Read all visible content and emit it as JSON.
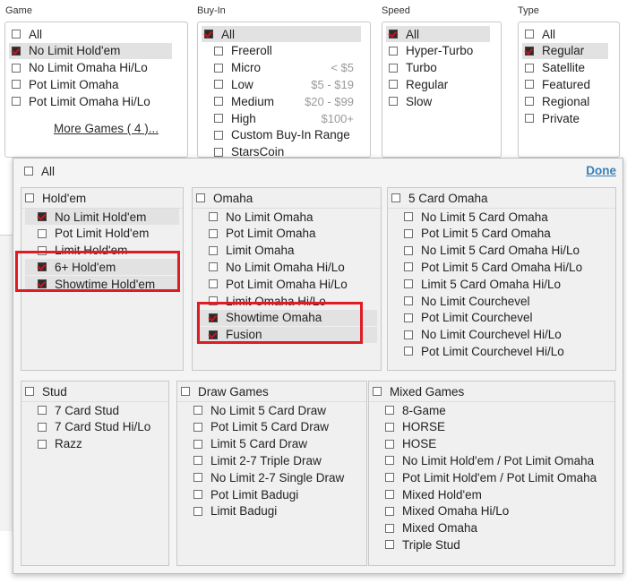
{
  "filters": {
    "game": {
      "label": "Game",
      "items": [
        {
          "label": "All",
          "checked": false
        },
        {
          "label": "No Limit Hold'em",
          "checked": true,
          "hl": true
        },
        {
          "label": "No Limit Omaha Hi/Lo",
          "checked": false
        },
        {
          "label": "Pot Limit Omaha",
          "checked": false
        },
        {
          "label": "Pot Limit Omaha Hi/Lo",
          "checked": false
        }
      ],
      "more_link": "More Games ( 4 )..."
    },
    "buyin": {
      "label": "Buy-In",
      "items": [
        {
          "label": "All",
          "checked": true,
          "hl": true,
          "price": ""
        },
        {
          "label": "Freeroll",
          "checked": false,
          "price": ""
        },
        {
          "label": "Micro",
          "checked": false,
          "price": "< $5"
        },
        {
          "label": "Low",
          "checked": false,
          "price": "$5 - $19"
        },
        {
          "label": "Medium",
          "checked": false,
          "price": "$20 - $99"
        },
        {
          "label": "High",
          "checked": false,
          "price": "$100+"
        },
        {
          "label": "Custom Buy-In Range",
          "checked": false,
          "price": ""
        },
        {
          "label": "StarsCoin",
          "checked": false,
          "price": ""
        }
      ]
    },
    "speed": {
      "label": "Speed",
      "items": [
        {
          "label": "All",
          "checked": true,
          "hl": true
        },
        {
          "label": "Hyper-Turbo",
          "checked": false
        },
        {
          "label": "Turbo",
          "checked": false
        },
        {
          "label": "Regular",
          "checked": false
        },
        {
          "label": "Slow",
          "checked": false
        }
      ]
    },
    "type": {
      "label": "Type",
      "items": [
        {
          "label": "All",
          "checked": false
        },
        {
          "label": "Regular",
          "checked": true,
          "hl": true
        },
        {
          "label": "Satellite",
          "checked": false
        },
        {
          "label": "Featured",
          "checked": false
        },
        {
          "label": "Regional",
          "checked": false
        },
        {
          "label": "Private",
          "checked": false
        }
      ]
    }
  },
  "popup": {
    "all_label": "All",
    "done_label": "Done",
    "groups": [
      {
        "id": "holdem",
        "title": "Hold'em",
        "items": [
          {
            "label": "No Limit Hold'em",
            "checked": true,
            "hl": true
          },
          {
            "label": "Pot Limit Hold'em",
            "checked": false
          },
          {
            "label": "Limit Hold'em",
            "checked": false
          },
          {
            "label": "6+ Hold'em",
            "checked": true,
            "hl": true
          },
          {
            "label": "Showtime Hold'em",
            "checked": true,
            "hl": true
          }
        ]
      },
      {
        "id": "omaha",
        "title": "Omaha",
        "items": [
          {
            "label": "No Limit Omaha",
            "checked": false
          },
          {
            "label": "Pot Limit Omaha",
            "checked": false
          },
          {
            "label": "Limit Omaha",
            "checked": false
          },
          {
            "label": "No Limit Omaha Hi/Lo",
            "checked": false
          },
          {
            "label": "Pot Limit Omaha Hi/Lo",
            "checked": false
          },
          {
            "label": "Limit Omaha Hi/Lo",
            "checked": false
          },
          {
            "label": "Showtime Omaha",
            "checked": true,
            "hl": true
          },
          {
            "label": "Fusion",
            "checked": true,
            "hl": true
          }
        ]
      },
      {
        "id": "five-card-omaha",
        "title": "5 Card Omaha",
        "items": [
          {
            "label": "No Limit 5 Card Omaha",
            "checked": false
          },
          {
            "label": "Pot Limit 5 Card Omaha",
            "checked": false
          },
          {
            "label": "No Limit 5 Card Omaha Hi/Lo",
            "checked": false
          },
          {
            "label": "Pot Limit 5 Card Omaha Hi/Lo",
            "checked": false
          },
          {
            "label": "Limit 5 Card Omaha Hi/Lo",
            "checked": false
          },
          {
            "label": "No Limit Courchevel",
            "checked": false
          },
          {
            "label": "Pot Limit Courchevel",
            "checked": false
          },
          {
            "label": "No Limit Courchevel Hi/Lo",
            "checked": false
          },
          {
            "label": "Pot Limit Courchevel Hi/Lo",
            "checked": false
          }
        ]
      },
      {
        "id": "stud",
        "title": "Stud",
        "items": [
          {
            "label": "7 Card Stud",
            "checked": false
          },
          {
            "label": "7 Card Stud Hi/Lo",
            "checked": false
          },
          {
            "label": "Razz",
            "checked": false
          }
        ]
      },
      {
        "id": "draw",
        "title": "Draw Games",
        "items": [
          {
            "label": "No Limit 5 Card Draw",
            "checked": false
          },
          {
            "label": "Pot Limit 5 Card Draw",
            "checked": false
          },
          {
            "label": "Limit 5 Card Draw",
            "checked": false
          },
          {
            "label": "Limit 2-7 Triple Draw",
            "checked": false
          },
          {
            "label": "No Limit 2-7 Single Draw",
            "checked": false
          },
          {
            "label": "Pot Limit Badugi",
            "checked": false
          },
          {
            "label": "Limit Badugi",
            "checked": false
          }
        ]
      },
      {
        "id": "mixed",
        "title": "Mixed Games",
        "items": [
          {
            "label": "8-Game",
            "checked": false
          },
          {
            "label": "HORSE",
            "checked": false
          },
          {
            "label": "HOSE",
            "checked": false
          },
          {
            "label": "No Limit Hold'em / Pot Limit Omaha",
            "checked": false
          },
          {
            "label": "Pot Limit Hold'em / Pot Limit Omaha",
            "checked": false
          },
          {
            "label": "Mixed Hold'em",
            "checked": false
          },
          {
            "label": "Mixed Omaha Hi/Lo",
            "checked": false
          },
          {
            "label": "Mixed Omaha",
            "checked": false
          },
          {
            "label": "Triple Stud",
            "checked": false
          }
        ]
      }
    ]
  },
  "colors": {
    "accent_check": "#c4161c",
    "highlight": "#e2e2e2",
    "annotation": "#e01b24",
    "done_link": "#3a7fb8"
  }
}
